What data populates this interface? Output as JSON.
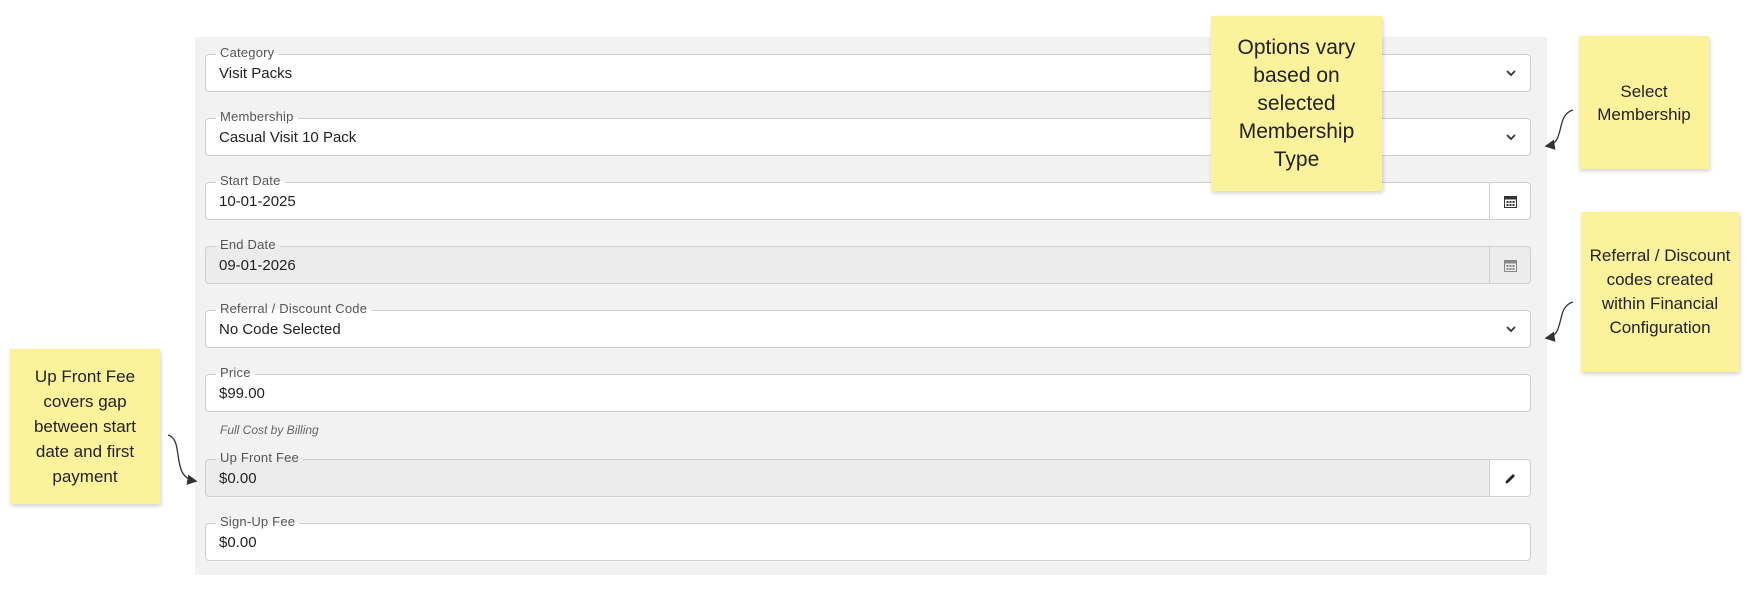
{
  "form": {
    "category": {
      "label": "Category",
      "value": "Visit Packs"
    },
    "membership": {
      "label": "Membership",
      "value": "Casual Visit 10 Pack"
    },
    "start_date": {
      "label": "Start Date",
      "value": "10-01-2025"
    },
    "end_date": {
      "label": "End Date",
      "value": "09-01-2026"
    },
    "referral": {
      "label": "Referral / Discount Code",
      "value": "No Code Selected"
    },
    "price": {
      "label": "Price",
      "value": "$99.00"
    },
    "price_hint": "Full Cost by Billing",
    "up_front_fee": {
      "label": "Up Front Fee",
      "value": "$0.00"
    },
    "sign_up_fee": {
      "label": "Sign-Up Fee",
      "value": "$0.00"
    }
  },
  "notes": {
    "options_vary": "Options vary based on selected Membership Type",
    "select_membership": "Select Membership",
    "referral_codes": "Referral / Discount codes created within Financial Configuration",
    "up_front_fee": "Up Front Fee covers gap between start date and first payment"
  },
  "icons": {
    "dropdown": "chevron-down-icon",
    "date": "calendar-icon",
    "edit": "pencil-icon"
  }
}
